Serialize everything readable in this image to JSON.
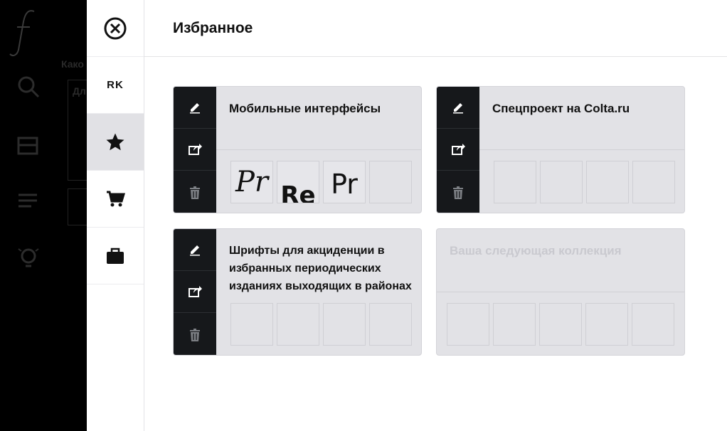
{
  "background_app": {
    "text1": "Како",
    "text2": "Дл"
  },
  "rail": {
    "close_icon": "close-circle-icon",
    "initials": "RK",
    "items": [
      {
        "icon": "star-icon",
        "active": true
      },
      {
        "icon": "cart-icon",
        "active": false
      },
      {
        "icon": "briefcase-icon",
        "active": false
      }
    ]
  },
  "panel": {
    "title": "Избранное"
  },
  "collections": [
    {
      "title": "Мобильные интерфейсы",
      "slots": [
        "Pr",
        "Re",
        "Pr",
        ""
      ]
    },
    {
      "title": "Спецпроект на Colta.ru",
      "slots": [
        "",
        "",
        "",
        ""
      ]
    },
    {
      "title": "Шрифты для акциденции в избранных периодических изданиях выходящих в районах",
      "slots": [
        "",
        "",
        "",
        ""
      ]
    },
    {
      "title": "Ваша следующая коллекция",
      "slots": [
        "",
        "",
        "",
        "",
        ""
      ]
    }
  ],
  "colors": {
    "tool_bg": "#16181b",
    "card_bg": "#e2e2e6",
    "active_rail": "#e1e1e5"
  }
}
